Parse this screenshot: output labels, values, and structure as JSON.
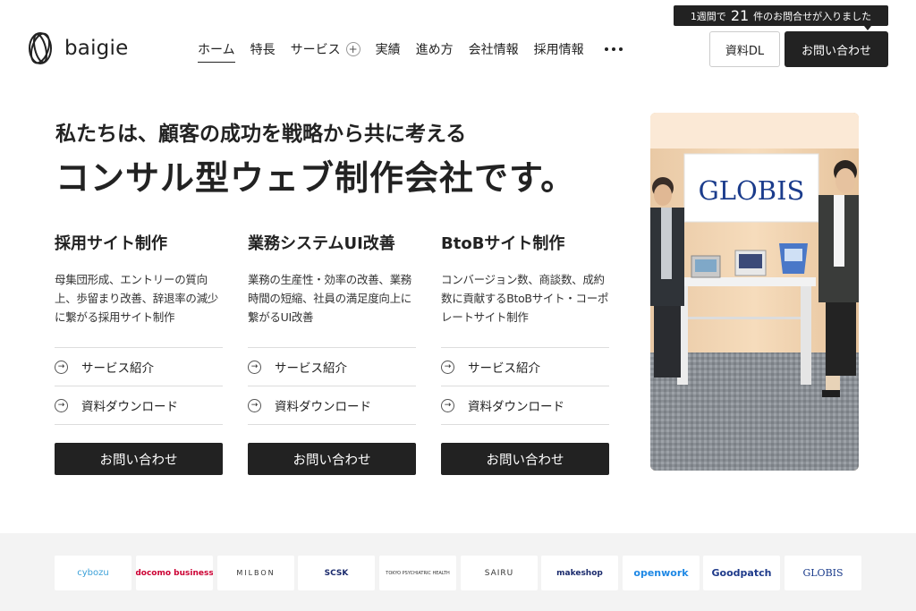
{
  "header": {
    "brand": "baigie",
    "nav": [
      {
        "label": "ホーム",
        "active": true
      },
      {
        "label": "特長"
      },
      {
        "label": "サービス",
        "expandable": true
      },
      {
        "label": "実績"
      },
      {
        "label": "進め方"
      },
      {
        "label": "会社情報"
      },
      {
        "label": "採用情報"
      }
    ],
    "notice": {
      "prefix": "1週間で",
      "count": "21",
      "suffix": "件のお問合せが入りました"
    },
    "dl_button": "資料DL",
    "contact_button": "お問い合わせ"
  },
  "hero": {
    "subtitle": "私たちは、顧客の成功を戦略から共に考える",
    "title": "コンサル型ウェブ制作会社です。"
  },
  "services": [
    {
      "title": "採用サイト制作",
      "description": "母集団形成、エントリーの質向上、歩留まり改善、辞退率の減少に繋がる採用サイト制作",
      "link1": "サービス紹介",
      "link2": "資料ダウンロード",
      "button": "お問い合わせ"
    },
    {
      "title": "業務システムUI改善",
      "description": "業務の生産性・効率の改善、業務時間の短縮、社員の満足度向上に繋がるUI改善",
      "link1": "サービス紹介",
      "link2": "資料ダウンロード",
      "button": "お問い合わせ"
    },
    {
      "title": "BtoBサイト制作",
      "description": "コンバージョン数、商談数、成約数に貢献するBtoBサイト・コーポレートサイト制作",
      "link1": "サービス紹介",
      "link2": "資料ダウンロード",
      "button": "お問い合わせ"
    }
  ],
  "photo": {
    "sign": "GLOBIS"
  },
  "client_logos": [
    {
      "name": "cybozu",
      "color": "#3aa0d8"
    },
    {
      "name": "docomo business",
      "color": "#cc0033"
    },
    {
      "name": "MILBON",
      "color": "#333333"
    },
    {
      "name": "SCSK",
      "color": "#1a2a6c"
    },
    {
      "name": "TOKYO PSYCHIATRIC HEALTH",
      "color": "#444444"
    },
    {
      "name": "SAIRU",
      "color": "#333333"
    },
    {
      "name": "makeshop",
      "color": "#1a2a6c"
    },
    {
      "name": "openwork",
      "color": "#1e88e5"
    },
    {
      "name": "Goodpatch",
      "color": "#1e3a8a"
    },
    {
      "name": "GLOBIS",
      "color": "#1b3c8c"
    }
  ],
  "colors": {
    "dark": "#222222",
    "band": "#f3f3f3"
  }
}
